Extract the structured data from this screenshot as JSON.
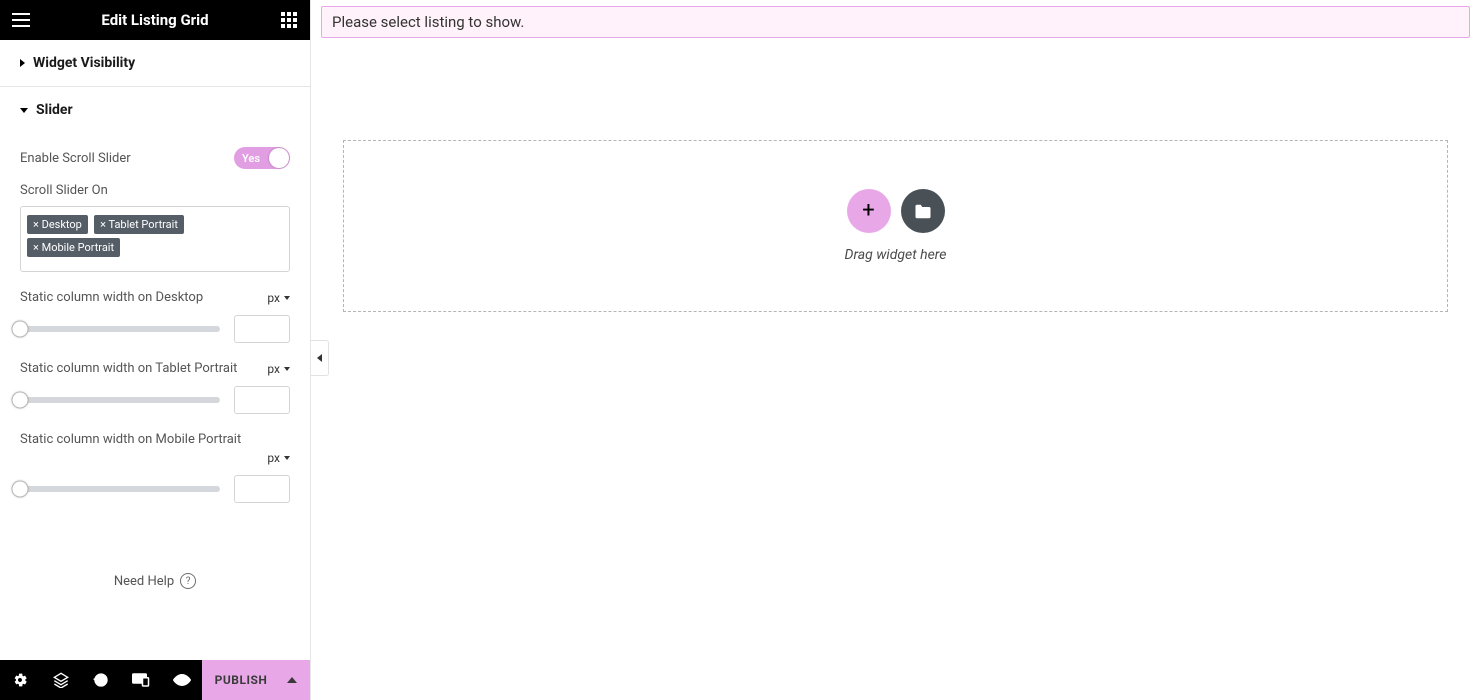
{
  "header": {
    "title": "Edit Listing Grid"
  },
  "sections": {
    "widget_visibility": {
      "title": "Widget Visibility"
    },
    "slider": {
      "title": "Slider",
      "enable_label": "Enable Scroll Slider",
      "enable_state_text": "Yes",
      "scroll_on_label": "Scroll Slider On",
      "tags": [
        "Desktop",
        "Tablet Portrait",
        "Mobile Portrait"
      ],
      "width_controls": [
        {
          "label": "Static column width on Desktop",
          "unit": "px",
          "value": ""
        },
        {
          "label": "Static column width on Tablet Portrait",
          "unit": "px",
          "value": ""
        },
        {
          "label": "Static column width on Mobile Portrait",
          "unit": "px",
          "value": ""
        }
      ]
    }
  },
  "help": {
    "label": "Need Help",
    "icon_glyph": "?"
  },
  "footer": {
    "publish_label": "PUBLISH"
  },
  "canvas": {
    "notice": "Please select listing to show.",
    "dropzone_hint": "Drag widget here"
  },
  "glyphs": {
    "tag_x": "×",
    "plus": "+"
  }
}
